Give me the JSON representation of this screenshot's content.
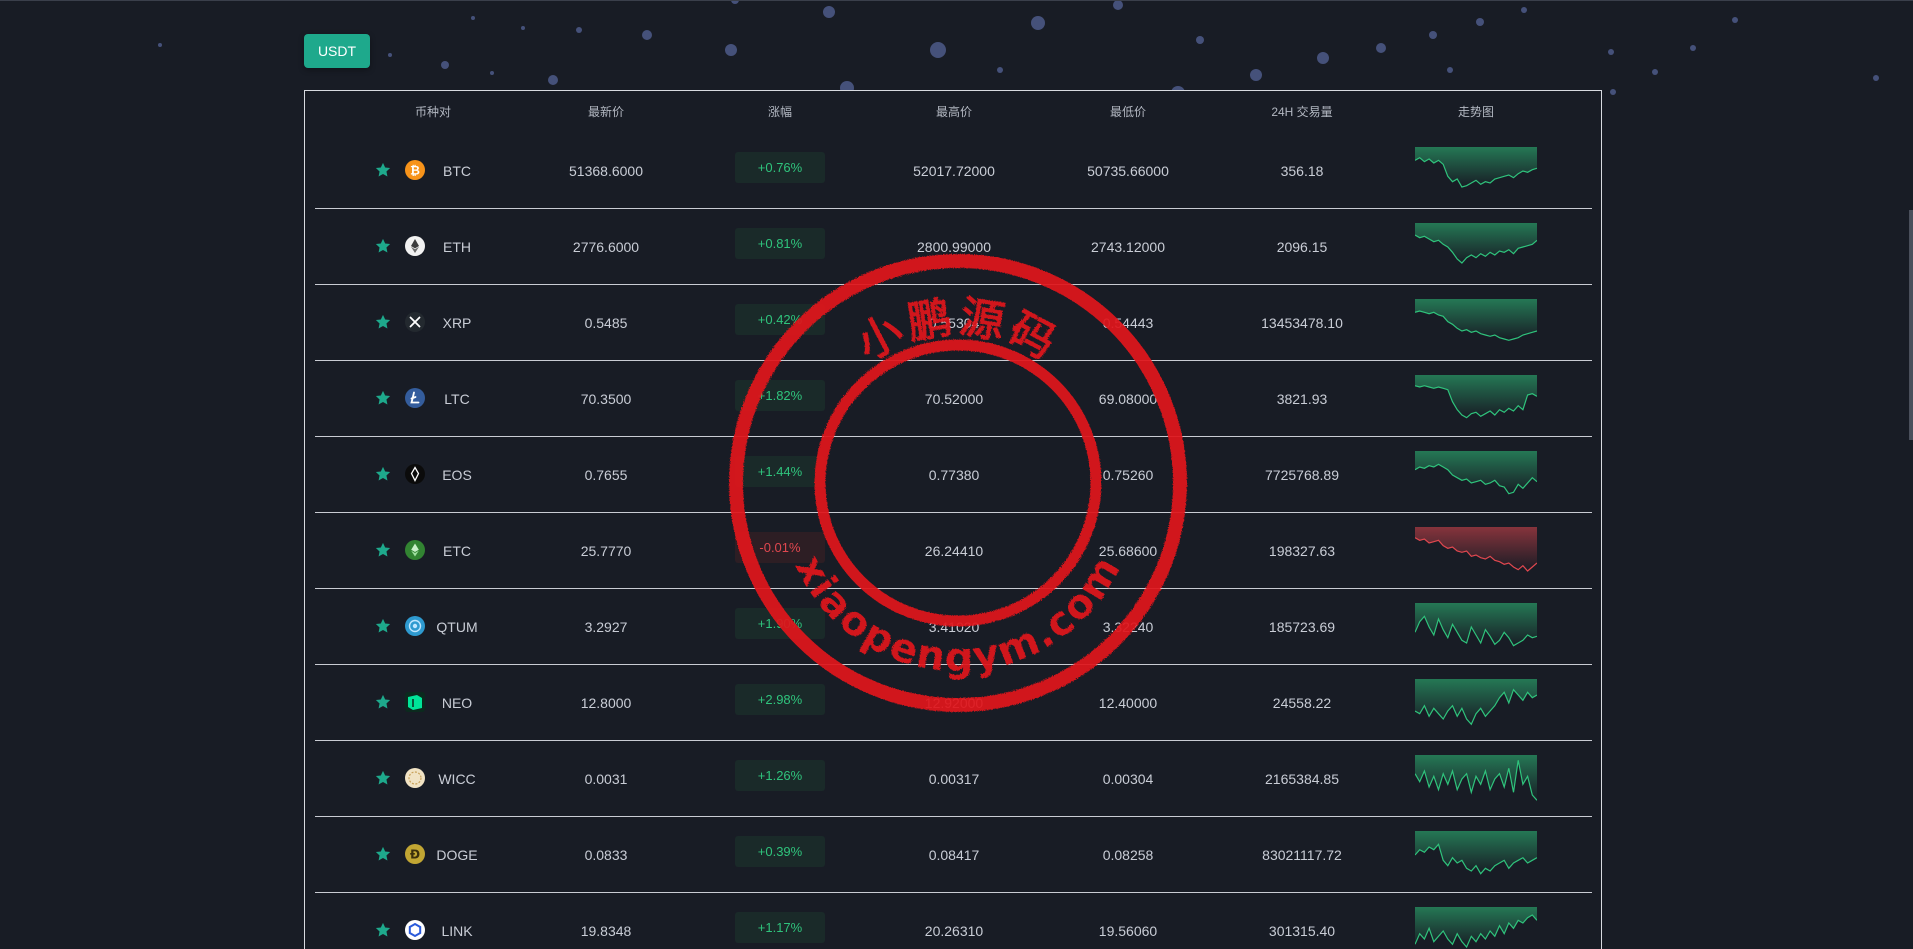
{
  "tab": {
    "label": "USDT"
  },
  "headers": [
    "币种对",
    "最新价",
    "涨幅",
    "最高价",
    "最低价",
    "24H 交易量",
    "走势图"
  ],
  "colors": {
    "accent": "#1ea98c",
    "up": "#2fc37c",
    "down": "#e0474f",
    "up_bg": "#1a2a29",
    "down_bg": "#2d1e24",
    "seal": "#e0151c"
  },
  "rows": [
    {
      "symbol": "BTC",
      "icon": "bitcoin-icon",
      "price": "51368.6000",
      "change": "+0.76%",
      "high": "52017.72000",
      "low": "50735.66000",
      "volume": "356.18",
      "trend": "up",
      "spark": [
        10,
        8,
        11,
        9,
        12,
        10,
        13,
        22,
        26,
        24,
        30,
        29,
        27,
        25,
        28,
        26,
        27,
        24,
        23,
        22,
        21,
        23,
        20,
        18,
        19,
        17,
        16
      ]
    },
    {
      "symbol": "ETH",
      "icon": "ethereum-icon",
      "price": "2776.6000",
      "change": "+0.81%",
      "high": "2800.99000",
      "low": "2743.12000",
      "volume": "2096.15",
      "trend": "up",
      "spark": [
        9,
        11,
        10,
        12,
        14,
        13,
        16,
        18,
        22,
        27,
        30,
        26,
        24,
        26,
        23,
        25,
        22,
        24,
        21,
        22,
        20,
        23,
        19,
        18,
        17,
        16,
        13
      ]
    },
    {
      "symbol": "XRP",
      "icon": "xrp-icon",
      "price": "0.5485",
      "change": "+0.42%",
      "high": "0.55304",
      "low": "0.54443",
      "volume": "13453478.10",
      "trend": "up",
      "spark": [
        10,
        9,
        10,
        11,
        10,
        12,
        13,
        17,
        19,
        22,
        24,
        23,
        25,
        24,
        26,
        27,
        28,
        27,
        29,
        30,
        31,
        30,
        29,
        27,
        26,
        25,
        24
      ]
    },
    {
      "symbol": "LTC",
      "icon": "litecoin-icon",
      "price": "70.3500",
      "change": "+1.82%",
      "high": "70.52000",
      "low": "69.08000",
      "volume": "3821.93",
      "trend": "up",
      "spark": [
        8,
        9,
        8,
        9,
        10,
        9,
        10,
        11,
        20,
        26,
        30,
        32,
        29,
        28,
        31,
        29,
        27,
        30,
        26,
        28,
        25,
        27,
        23,
        26,
        15,
        14,
        16
      ]
    },
    {
      "symbol": "EOS",
      "icon": "eos-icon",
      "price": "0.7655",
      "change": "+1.44%",
      "high": "0.77380",
      "low": "0.75260",
      "volume": "7725768.89",
      "trend": "up",
      "spark": [
        14,
        12,
        13,
        11,
        12,
        10,
        12,
        14,
        18,
        20,
        22,
        21,
        24,
        23,
        22,
        25,
        24,
        22,
        26,
        27,
        32,
        31,
        25,
        28,
        24,
        20,
        23
      ]
    },
    {
      "symbol": "ETC",
      "icon": "etc-icon",
      "price": "25.7770",
      "change": "-0.01%",
      "high": "26.24410",
      "low": "25.68600",
      "volume": "198327.63",
      "trend": "down",
      "spark": [
        8,
        10,
        9,
        12,
        11,
        10,
        14,
        16,
        15,
        18,
        19,
        18,
        22,
        21,
        23,
        24,
        22,
        25,
        26,
        28,
        27,
        30,
        32,
        29,
        33,
        30,
        27
      ]
    },
    {
      "symbol": "QTUM",
      "icon": "qtum-icon",
      "price": "3.2927",
      "change": "+1.90%",
      "high": "3.41020",
      "low": "3.32240",
      "volume": "185723.69",
      "trend": "up",
      "spark": [
        22,
        14,
        10,
        18,
        24,
        12,
        20,
        26,
        16,
        22,
        28,
        30,
        18,
        24,
        30,
        20,
        25,
        31,
        28,
        22,
        26,
        32,
        30,
        28,
        24,
        26,
        25
      ]
    },
    {
      "symbol": "NEO",
      "icon": "neo-icon",
      "price": "12.8000",
      "change": "+2.98%",
      "high": "12.92000",
      "low": "12.40000",
      "volume": "24558.22",
      "trend": "up",
      "spark": [
        24,
        26,
        20,
        28,
        22,
        26,
        30,
        24,
        20,
        28,
        22,
        30,
        34,
        26,
        22,
        28,
        24,
        20,
        14,
        10,
        18,
        8,
        12,
        16,
        10,
        14,
        12
      ]
    },
    {
      "symbol": "WICC",
      "icon": "wicc-icon",
      "price": "0.0031",
      "change": "+1.26%",
      "high": "0.00317",
      "low": "0.00304",
      "volume": "2165384.85",
      "trend": "up",
      "spark": [
        14,
        20,
        12,
        24,
        16,
        26,
        14,
        22,
        12,
        26,
        18,
        14,
        28,
        16,
        22,
        12,
        26,
        18,
        14,
        24,
        10,
        28,
        4,
        22,
        16,
        30,
        34
      ]
    },
    {
      "symbol": "DOGE",
      "icon": "dogecoin-icon",
      "price": "0.0833",
      "change": "+0.39%",
      "high": "0.08417",
      "low": "0.08258",
      "volume": "83021117.72",
      "trend": "up",
      "spark": [
        18,
        14,
        16,
        12,
        14,
        10,
        22,
        26,
        20,
        24,
        22,
        28,
        30,
        26,
        32,
        28,
        30,
        26,
        24,
        22,
        28,
        24,
        22,
        20,
        24,
        22,
        20
      ]
    },
    {
      "symbol": "LINK",
      "icon": "chainlink-icon",
      "price": "19.8348",
      "change": "+1.17%",
      "high": "20.26310",
      "low": "19.56060",
      "volume": "301315.40",
      "trend": "up",
      "spark": [
        28,
        20,
        24,
        16,
        26,
        22,
        18,
        24,
        28,
        20,
        26,
        30,
        22,
        26,
        20,
        24,
        18,
        22,
        14,
        20,
        12,
        16,
        10,
        12,
        8,
        6,
        10
      ]
    }
  ],
  "seal": {
    "top_text": "小鹏源码",
    "bottom_text": "xiaopengym.com"
  }
}
